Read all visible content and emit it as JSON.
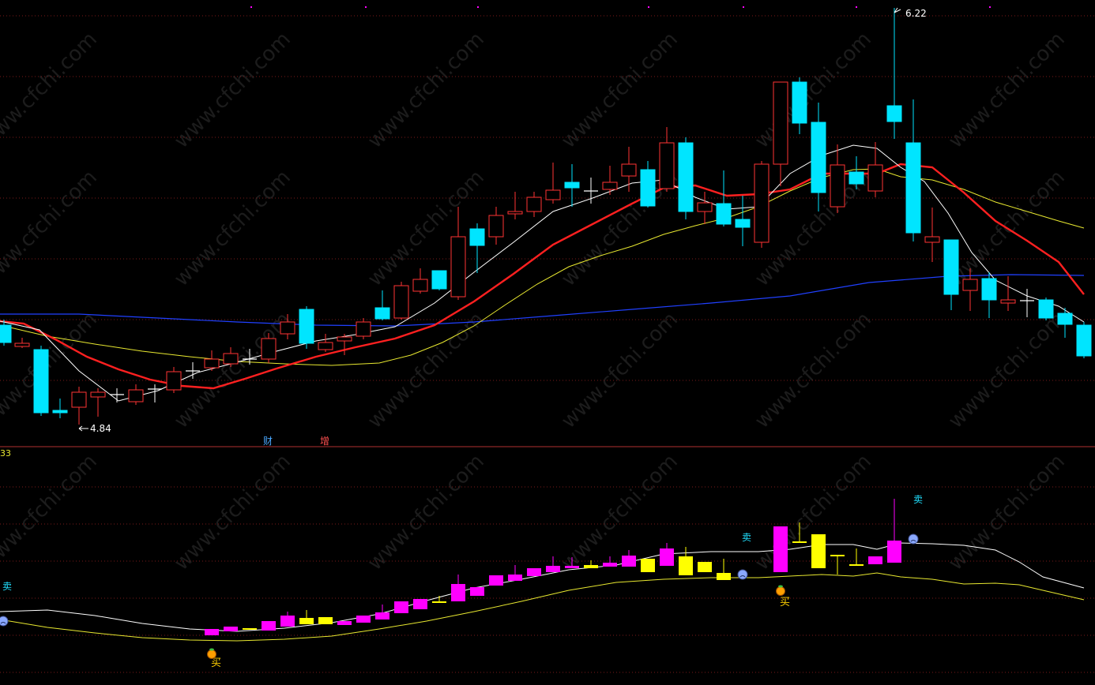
{
  "chart_data": [
    {
      "type": "candlestick",
      "panel": "price",
      "markers": {
        "high_label": "6.22",
        "low_label": "4.84"
      },
      "annotations": [
        "财",
        "增"
      ],
      "moving_averages": [
        {
          "color": "#ffffff"
        },
        {
          "color": "#ff2020"
        },
        {
          "color": "#e8e830"
        },
        {
          "color": "#2040ff"
        }
      ],
      "colors": {
        "up": "#ff3333",
        "down": "#00e5ff",
        "doji": "#ffffff",
        "grid": "#7a1a1a",
        "watermark": "#1c1c1c"
      }
    },
    {
      "type": "bar",
      "panel": "indicator",
      "top_left_value": "33",
      "signals": [
        {
          "kind": "buy",
          "label": "买"
        },
        {
          "kind": "buy",
          "label": "买"
        },
        {
          "kind": "sell",
          "label": "卖"
        },
        {
          "kind": "sell",
          "label": "卖"
        },
        {
          "kind": "sell",
          "label": "卖"
        }
      ],
      "colors": {
        "rise": "#ff00ff",
        "fall": "#ffff00",
        "line_upper": "#ffffff",
        "line_lower": "#e8e830"
      }
    }
  ],
  "watermark_text": "www.cfchi.com"
}
